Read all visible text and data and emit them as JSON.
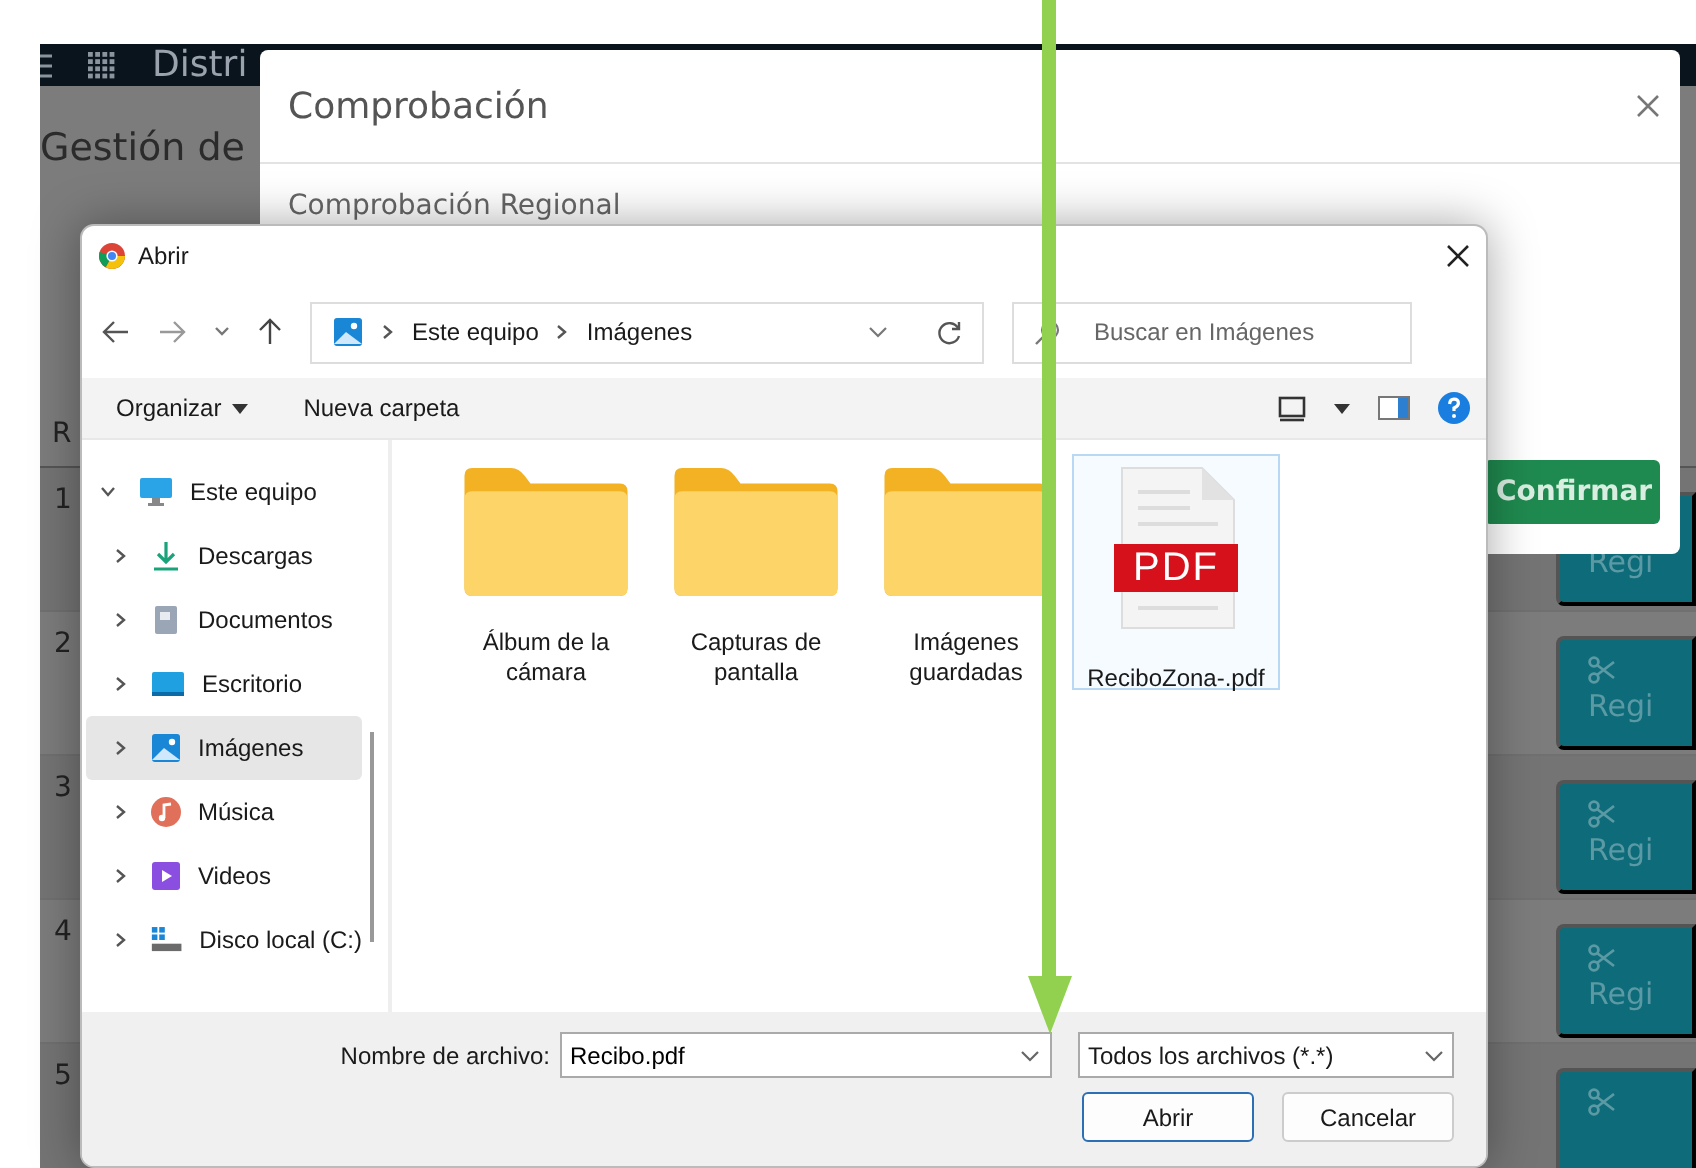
{
  "background_page": {
    "header_title": "Distri",
    "page_title": "Gestión de",
    "column_header": "R",
    "rows": [
      {
        "number": "1",
        "button": "Regi"
      },
      {
        "number": "2",
        "button": "Regi"
      },
      {
        "number": "3",
        "button": "Regi"
      },
      {
        "number": "4",
        "button": "Regi"
      },
      {
        "number": "5"
      }
    ]
  },
  "modal": {
    "title": "Comprobación",
    "subtitle": "Comprobación Regional",
    "confirm_button": "Confirmar"
  },
  "file_dialog": {
    "title": "Abrir",
    "breadcrumb": [
      "Este equipo",
      "Imágenes"
    ],
    "search": {
      "placeholder": "Buscar en Imágenes"
    },
    "toolbar": [
      "Organizar",
      "Nueva carpeta"
    ],
    "nav_tree": [
      {
        "label": "Este equipo",
        "expanded": true,
        "selected": false,
        "children": [
          {
            "label": "Descargas",
            "expanded": false,
            "selected": false
          },
          {
            "label": "Documentos",
            "expanded": false,
            "selected": false
          },
          {
            "label": "Escritorio",
            "expanded": false,
            "selected": false
          },
          {
            "label": "Imágenes",
            "expanded": false,
            "selected": true
          },
          {
            "label": "Música",
            "expanded": false,
            "selected": false
          },
          {
            "label": "Videos",
            "expanded": false,
            "selected": false
          },
          {
            "label": "Disco local (C:)",
            "expanded": false,
            "selected": false
          }
        ]
      }
    ],
    "files": [
      {
        "kind": "folder",
        "name": "Álbum de la cámara",
        "selected": false
      },
      {
        "kind": "folder",
        "name": "Capturas de pantalla",
        "selected": false
      },
      {
        "kind": "folder",
        "name": "Imágenes guardadas",
        "selected": false
      },
      {
        "kind": "pdf",
        "badge": "PDF",
        "name": "ReciboZona-.pdf",
        "selected": true
      }
    ],
    "filename_label": "Nombre de archivo:",
    "filename": "Recibo.pdf",
    "file_type": "Todos los archivos (*.*)",
    "buttons": [
      {
        "label": "Abrir",
        "kind": "default"
      },
      {
        "label": "Cancelar",
        "kind": "normal"
      }
    ]
  }
}
